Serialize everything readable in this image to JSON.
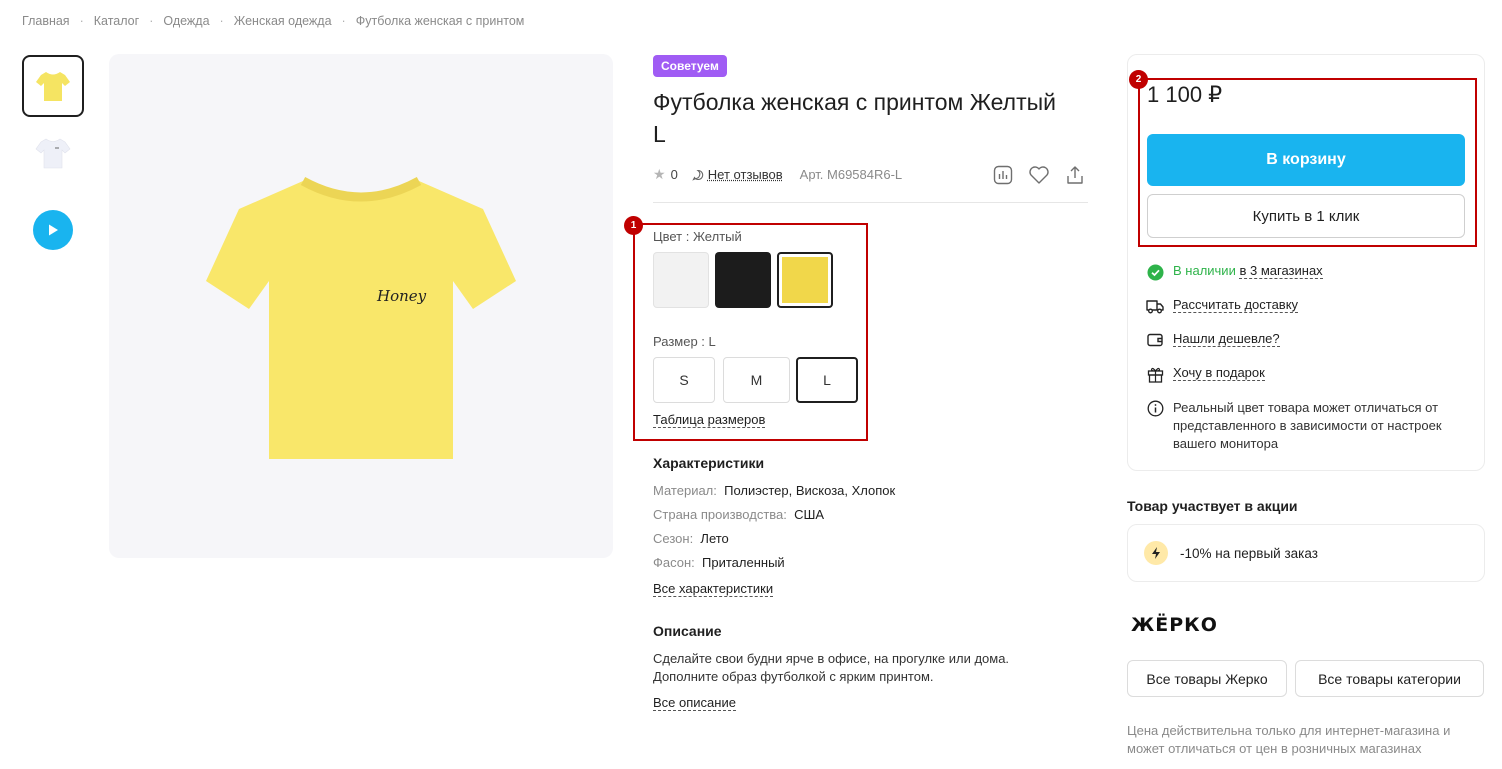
{
  "breadcrumb": [
    "Главная",
    "Каталог",
    "Одежда",
    "Женская одежда",
    "Футболка женская с принтом"
  ],
  "gallery": {
    "thumbnails": [
      {
        "name": "thumb-yellow-tshirt",
        "color": "#f5e462"
      },
      {
        "name": "thumb-white-tshirt",
        "color": "#eef0f8"
      }
    ],
    "video_icon": "play-icon",
    "main_image": {
      "shirt_color": "#f9e76a",
      "print_text": "Honey"
    }
  },
  "product": {
    "badge": "Советуем",
    "title": "Футболка женская с принтом Желтый L",
    "rating": "0",
    "reviews": "Нет отзывов",
    "sku": "Арт. M69584R6-L",
    "actions": [
      "compare-icon",
      "favorite-icon",
      "share-icon"
    ]
  },
  "options": {
    "color_label": "Цвет : Желтый",
    "colors": [
      {
        "name": "white",
        "hex": "#f2f2f2",
        "selected": false
      },
      {
        "name": "black",
        "hex": "#1c1c1c",
        "selected": false
      },
      {
        "name": "yellow",
        "hex": "#f1d74a",
        "selected": true
      }
    ],
    "size_label": "Размер : L",
    "sizes": [
      {
        "label": "S",
        "selected": false
      },
      {
        "label": "M",
        "selected": false
      },
      {
        "label": "L",
        "selected": true
      }
    ],
    "size_table_link": "Таблица размеров",
    "highlight_number": "1"
  },
  "characteristics": {
    "title": "Характеристики",
    "rows": [
      {
        "key": "Материал",
        "value": "Полиэстер, Вискоза, Хлопок"
      },
      {
        "key": "Страна производства",
        "value": "США"
      },
      {
        "key": "Сезон",
        "value": "Лето"
      },
      {
        "key": "Фасон",
        "value": "Приталенный"
      }
    ],
    "all_link": "Все характеристики"
  },
  "description": {
    "title": "Описание",
    "text": "Сделайте свои будни ярче в офисе, на прогулке или дома. Дополните образ футболкой с ярким принтом.",
    "all_link": "Все описание"
  },
  "buy": {
    "highlight_number": "2",
    "price": "1 100 ₽",
    "cart_button": "В корзину",
    "one_click_button": "Купить в 1 клик",
    "stock_status": "В наличии",
    "stock_location": "в 3 магазинах",
    "delivery_link": "Рассчитать доставку",
    "cheaper_link": "Нашли дешевле?",
    "gift_link": "Хочу в подарок",
    "color_note": "Реальный цвет товара может отличаться от представленного в зависимости от настроек вашего монитора"
  },
  "promo": {
    "title": "Товар участвует в акции",
    "offer": "-10% на первый заказ"
  },
  "brand": {
    "logo_text": "ЖЁРКО",
    "all_brand_button": "Все товары Жерко",
    "all_category_button": "Все товары категории"
  },
  "footer_note": "Цена действительна только для интернет-магазина и может отличаться от цен в розничных магазинах",
  "colors": {
    "accent": "#19b4ef",
    "badge": "#a05cf4",
    "highlight": "#c00000",
    "stock": "#2eb34a"
  }
}
